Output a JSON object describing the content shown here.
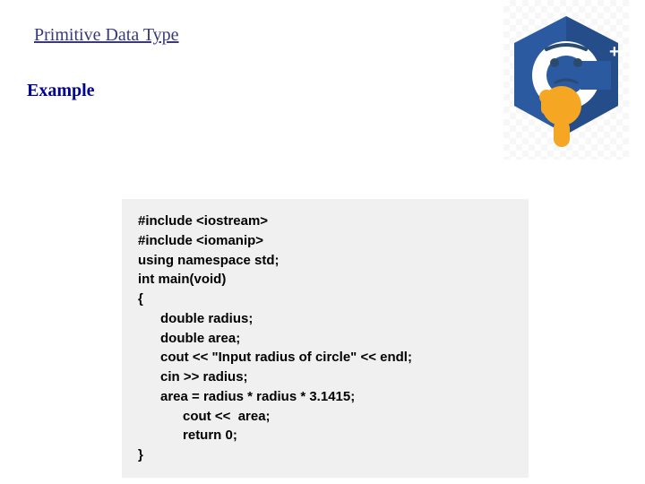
{
  "title": "Primitive Data Type",
  "example_label": "Example",
  "code": "#include <iostream>\n#include <iomanip>\nusing namespace std;\nint main(void)\n{\n      double radius;\n      double area;\n      cout << \"Input radius of circle\" << endl;\n      cin >> radius;\n      area = radius * radius * 3.1415;\n            cout <<  area;\n            return 0;\n}"
}
